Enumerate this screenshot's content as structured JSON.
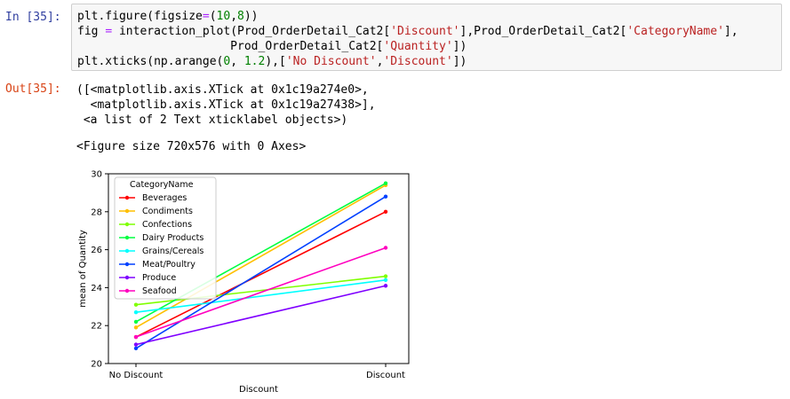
{
  "prompts": {
    "input": "In [35]:",
    "output": "Out[35]:"
  },
  "code": {
    "line1": [
      "plt.figure(figsize",
      "=",
      "(",
      "10",
      ",",
      "8",
      "))"
    ],
    "line2": [
      "fig ",
      "=",
      " interaction_plot(Prod_OrderDetail_Cat2[",
      "'Discount'",
      "],Prod_OrderDetail_Cat2[",
      "'CategoryName'",
      "],"
    ],
    "line3": [
      "                      Prod_OrderDetail_Cat2[",
      "'Quantity'",
      "])"
    ],
    "line4": [
      "plt.xticks(np.arange(",
      "0",
      ", ",
      "1.2",
      "),[",
      "'No Discount'",
      ",",
      "'Discount'",
      "])"
    ]
  },
  "output": {
    "line1": "([<matplotlib.axis.XTick at 0x1c19a274e0>,",
    "line2": "  <matplotlib.axis.XTick at 0x1c19a27438>],",
    "line3": " <a list of 2 Text xticklabel objects>)",
    "figure_size": "<Figure size 720x576 with 0 Axes>"
  },
  "chart_data": {
    "type": "line",
    "categories": [
      "No Discount",
      "Discount"
    ],
    "xlabel": "Discount",
    "ylabel": "mean of Quantity",
    "ylim": [
      20,
      30
    ],
    "yticks": [
      20,
      22,
      24,
      26,
      28,
      30
    ],
    "legend_title": "CategoryName",
    "legend_position": "top-left",
    "series": [
      {
        "name": "Beverages",
        "color": "#ff0000",
        "values": [
          21.4,
          28.0
        ]
      },
      {
        "name": "Condiments",
        "color": "#ffbf00",
        "values": [
          21.9,
          29.4
        ]
      },
      {
        "name": "Confections",
        "color": "#7fff00",
        "values": [
          23.1,
          24.6
        ]
      },
      {
        "name": "Dairy Products",
        "color": "#00ff40",
        "values": [
          22.2,
          29.5
        ]
      },
      {
        "name": "Grains/Cereals",
        "color": "#00ffff",
        "values": [
          22.7,
          24.4
        ]
      },
      {
        "name": "Meat/Poultry",
        "color": "#0040ff",
        "values": [
          20.8,
          28.8
        ]
      },
      {
        "name": "Produce",
        "color": "#7f00ff",
        "values": [
          21.0,
          24.1
        ]
      },
      {
        "name": "Seafood",
        "color": "#ff00bf",
        "values": [
          21.4,
          26.1
        ]
      }
    ]
  }
}
